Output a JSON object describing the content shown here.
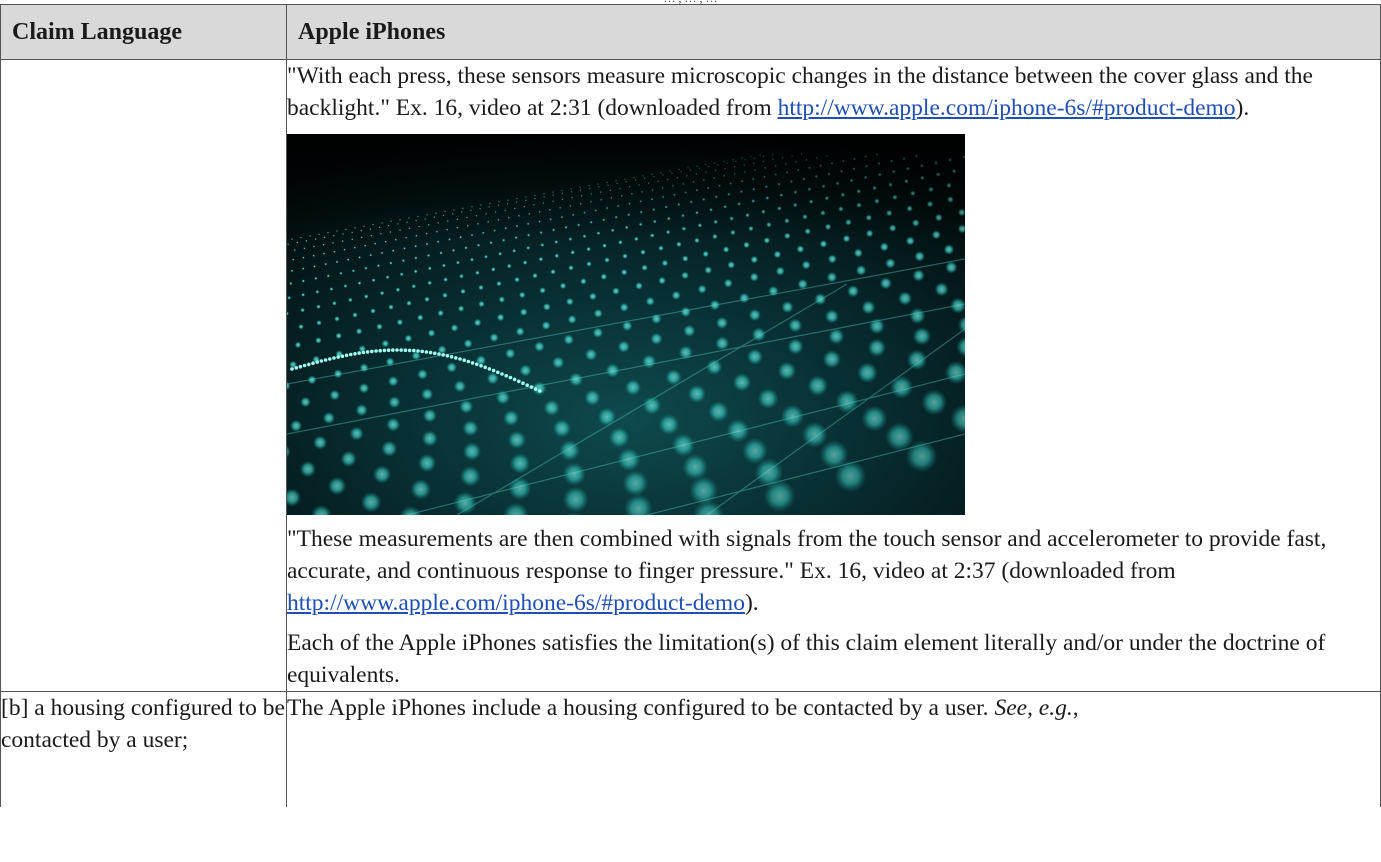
{
  "page": {
    "top_line_fragment": "… , … , …"
  },
  "table": {
    "headers": {
      "claim_language": "Claim Language",
      "apple_iphones": "Apple iPhones"
    },
    "row1": {
      "quote1_text": "\"With each press, these sensors measure microscopic changes in the distance between the cover glass and the backlight.\"  Ex. 16, video at 2:31 (downloaded from ",
      "quote1_link": "http://www.apple.com/iphone-6s/#product-demo",
      "quote1_end": ").",
      "quote2_text": "\"These measurements are then combined with signals from the touch sensor and accelerometer to provide fast, accurate, and continuous response to finger pressure.\"  Ex. 16, video at 2:37 (downloaded from ",
      "quote2_link": "http://www.apple.com/iphone-6s/#product-demo",
      "quote2_end": ").",
      "conclusion": "Each of the Apple iPhones satisfies the limitation(s) of this claim element literally and/or under the doctrine of equivalents."
    },
    "row2": {
      "claim": "[b] a housing configured to be contacted by a user;",
      "text": "The Apple iPhones include a housing configured to be contacted by a user.  ",
      "see": "See, e.g.",
      "see_end": ","
    }
  },
  "colors": {
    "header_bg": "#d9d9d9",
    "link": "#1f4fb4",
    "border": "#555555",
    "image_glow": "#3fe0d0"
  }
}
